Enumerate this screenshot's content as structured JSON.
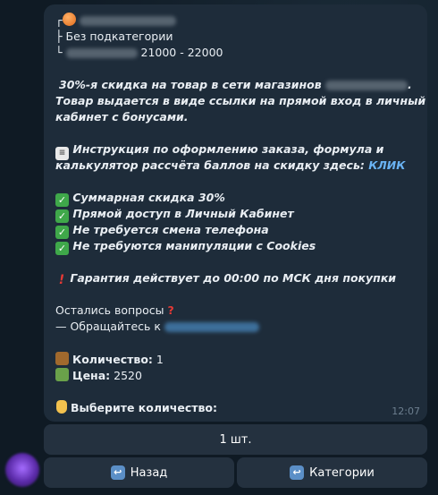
{
  "message": {
    "header_corner_top": "┌",
    "header_category": "",
    "header_branch_mid": "├",
    "header_subcategory": "Без подкатегории",
    "header_branch_end": "└",
    "header_range": "21000 - 22000",
    "desc_line1_prefix": "30%-я скидка на товар в сети магазинов",
    "desc_line1_suffix": ".",
    "desc_line2": "Товар выдается в виде ссылки на прямой вход в личный",
    "desc_line3": "кабинет с бонусами.",
    "instr_line1": "Инструкция по оформлению заказа, формула и",
    "instr_line2_text": "калькулятор рассчёта баллов на скидку здесь:",
    "instr_link": "КЛИК",
    "features": [
      "Суммарная скидка 30%",
      "Прямой доступ в Личный Кабинет",
      "Не требуется смена телефона",
      "Не требуются манипуляции с Cookies"
    ],
    "guarantee": "Гарантия действует до 00:00 по МСК дня покупки",
    "questions": "Остались вопросы",
    "contact_prefix": "— Обращайтесь к",
    "quantity_label": "Количество:",
    "quantity_value": "1",
    "price_label": "Цена:",
    "price_value": "2520",
    "choose": "Выберите количество:",
    "time": "12:07"
  },
  "keyboard": {
    "qty_button": "1 шт.",
    "back_button": "Назад",
    "categories_button": "Категории"
  },
  "icons": {
    "category": "basketball-emoji",
    "instruction": "receipt-emoji",
    "feature": "check-mark-emoji",
    "warning": "exclamation-emoji",
    "question": "question-mark-emoji",
    "quantity": "package-emoji",
    "price": "money-emoji",
    "pointer": "pointing-down-emoji",
    "back": "return-arrow-icon"
  }
}
